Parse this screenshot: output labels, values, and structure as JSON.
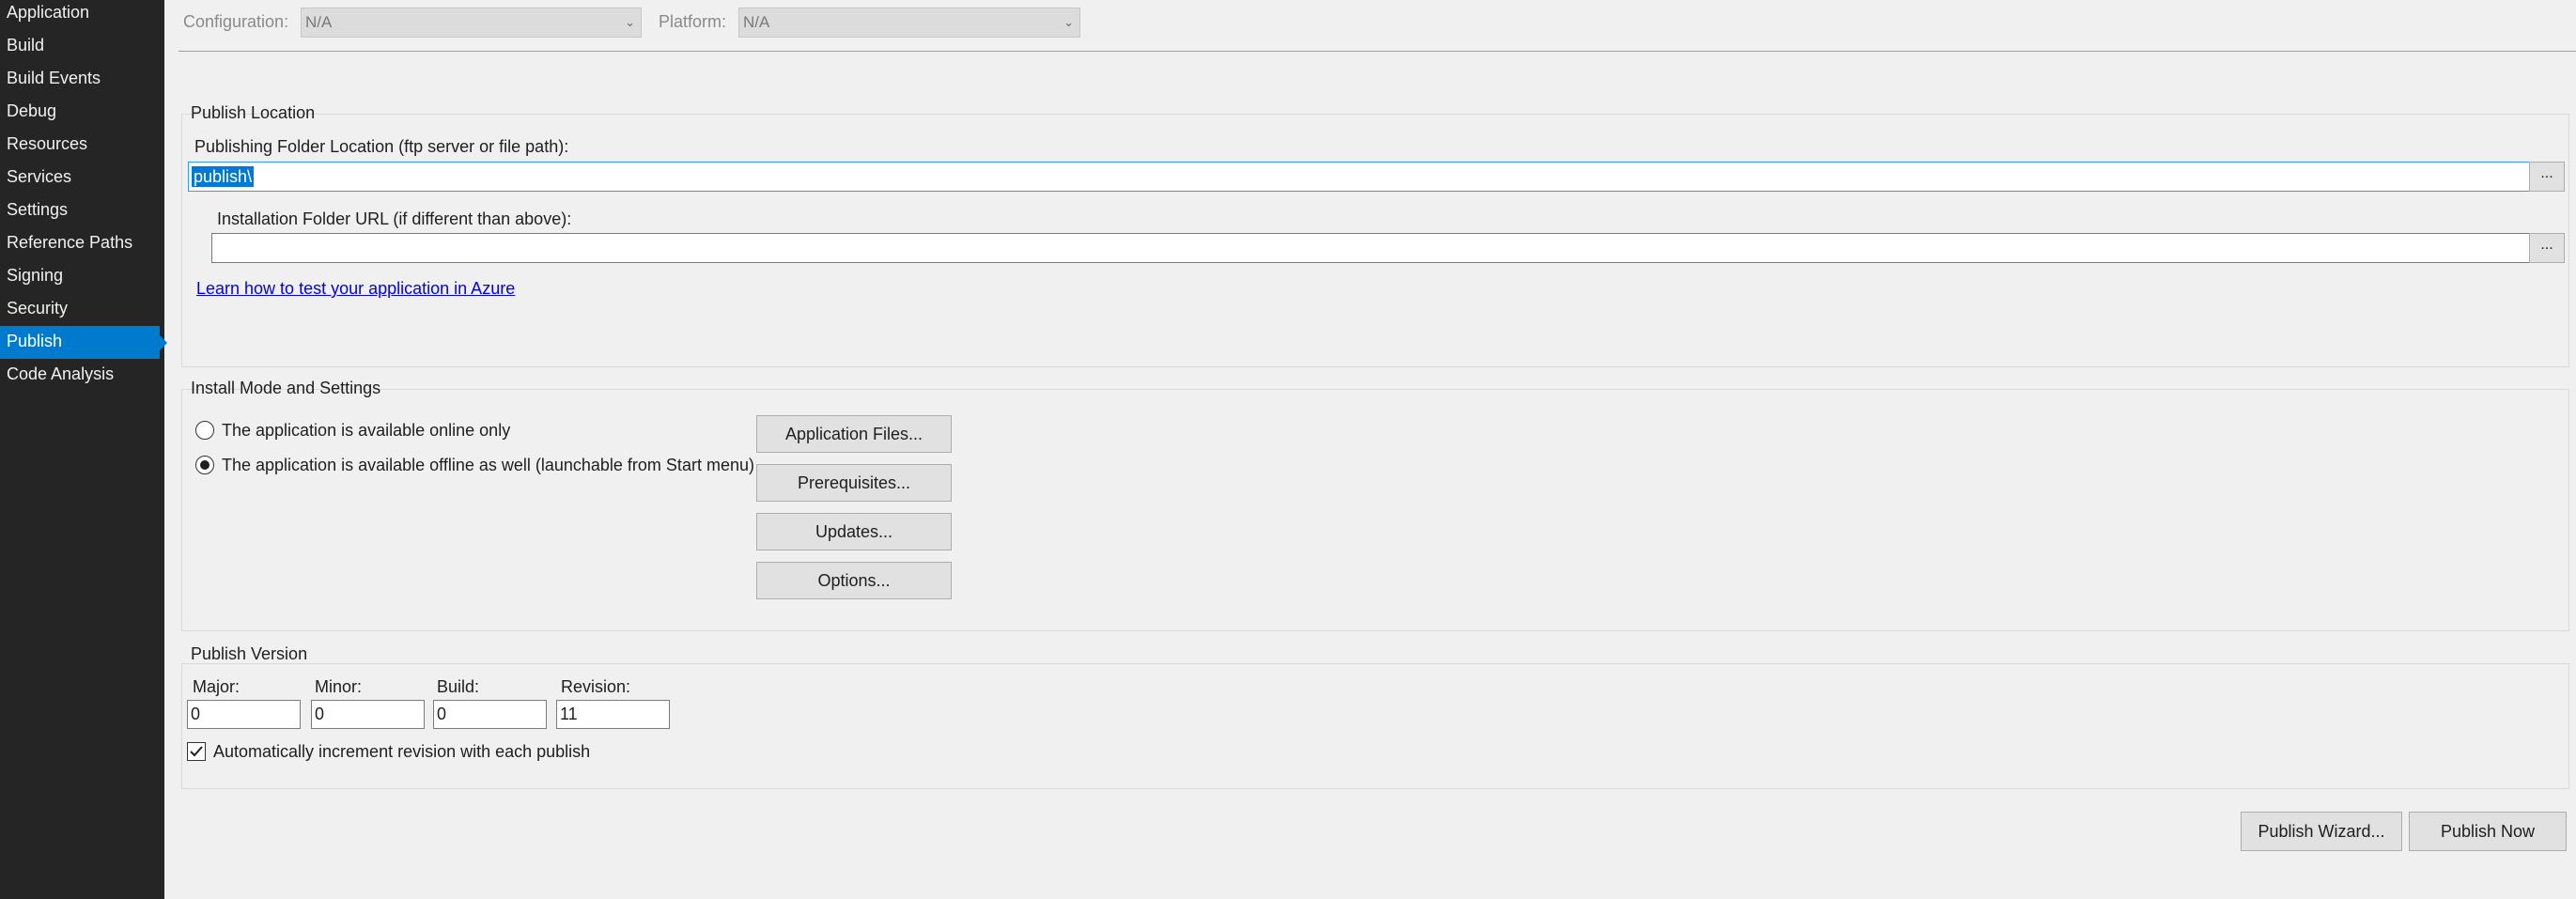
{
  "sidebar": {
    "items": [
      {
        "label": "Application"
      },
      {
        "label": "Build"
      },
      {
        "label": "Build Events"
      },
      {
        "label": "Debug"
      },
      {
        "label": "Resources"
      },
      {
        "label": "Services"
      },
      {
        "label": "Settings"
      },
      {
        "label": "Reference Paths"
      },
      {
        "label": "Signing"
      },
      {
        "label": "Security"
      },
      {
        "label": "Publish",
        "active": true
      },
      {
        "label": "Code Analysis"
      }
    ],
    "active_color": "#007acc"
  },
  "header": {
    "configuration_label": "Configuration:",
    "configuration_value": "N/A",
    "platform_label": "Platform:",
    "platform_value": "N/A"
  },
  "publish_location": {
    "title": "Publish Location",
    "folder_label": "Publishing Folder Location (ftp server or file path):",
    "folder_value": "publish\\",
    "browse_label": "...",
    "install_url_label": "Installation Folder URL (if different than above):",
    "install_url_value": "",
    "install_browse_label": "...",
    "azure_link": "Learn how to test your application in Azure"
  },
  "install_mode": {
    "title": "Install Mode and Settings",
    "online_only_label": "The application is available online only",
    "offline_label": "The application is available offline as well (launchable from Start menu)",
    "selected": "offline",
    "buttons": {
      "application_files": "Application Files...",
      "prerequisites": "Prerequisites...",
      "updates": "Updates...",
      "options": "Options..."
    }
  },
  "publish_version": {
    "title": "Publish Version",
    "major_label": "Major:",
    "minor_label": "Minor:",
    "build_label": "Build:",
    "revision_label": "Revision:",
    "major": "0",
    "minor": "0",
    "build": "0",
    "revision": "11",
    "auto_increment_label": "Automatically increment revision with each publish",
    "auto_increment_checked": true
  },
  "footer": {
    "publish_wizard_label": "Publish Wizard...",
    "publish_now_label": "Publish Now"
  }
}
